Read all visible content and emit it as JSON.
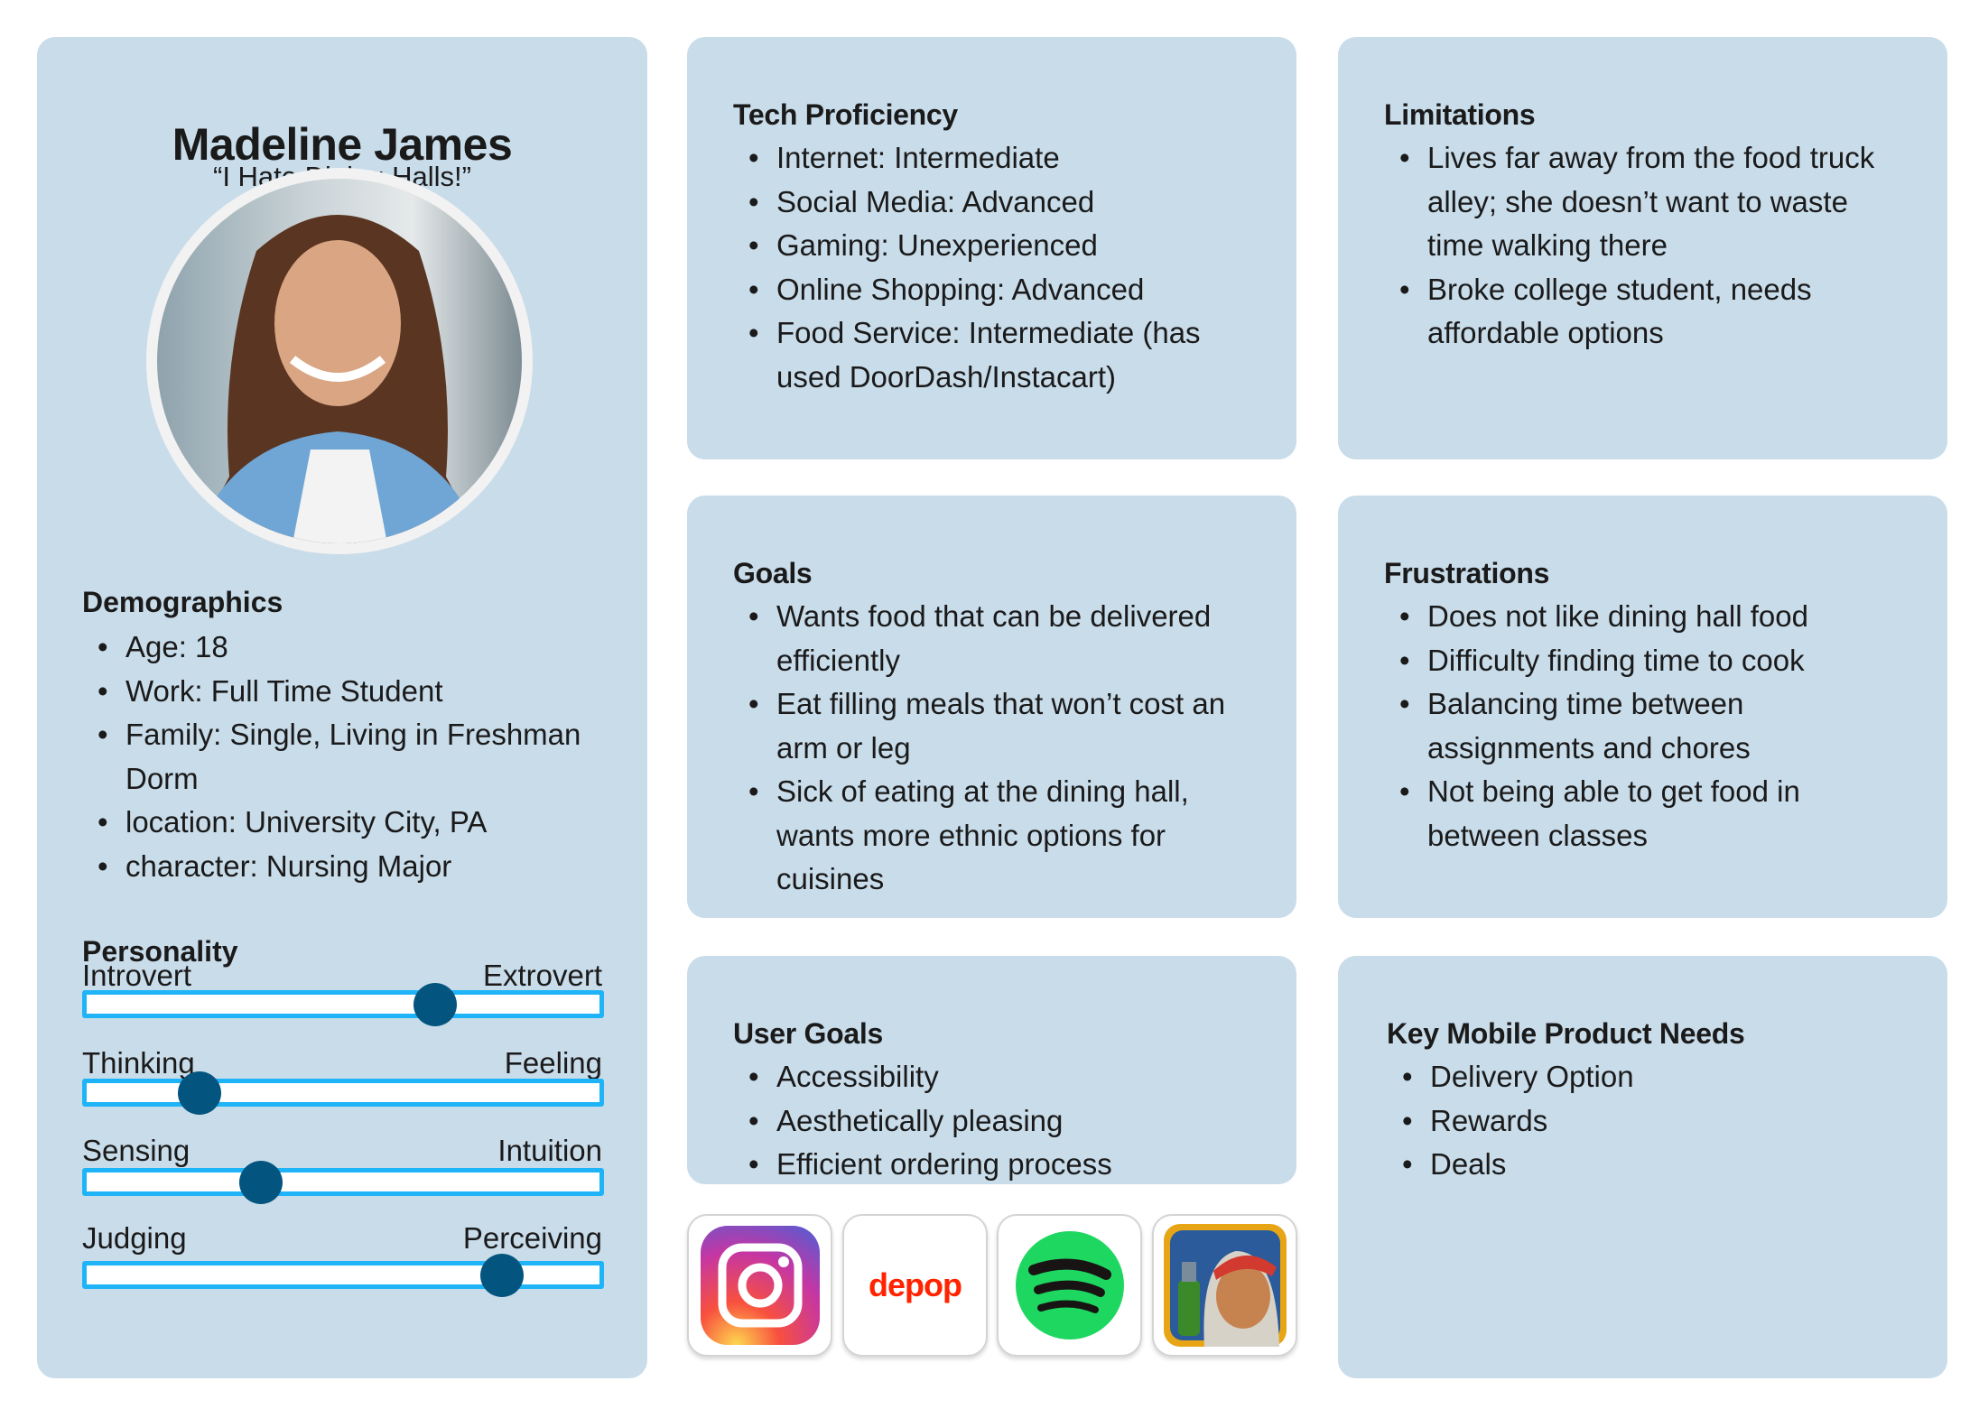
{
  "persona": {
    "name": "Madeline James",
    "quote": "“I Hate Dining Halls!”"
  },
  "demographics": {
    "title": "Demographics",
    "items": [
      "Age: 18",
      "Work: Full Time Student",
      "Family: Single, Living in Freshman Dorm",
      "location: University City, PA",
      "character: Nursing Major"
    ]
  },
  "personality": {
    "title": "Personality",
    "scales": [
      {
        "left": "Introvert",
        "right": "Extrovert",
        "value": 0.68
      },
      {
        "left": "Thinking",
        "right": "Feeling",
        "value": 0.22
      },
      {
        "left": "Sensing",
        "right": "Intuition",
        "value": 0.34
      },
      {
        "left": "Judging",
        "right": "Perceiving",
        "value": 0.81
      }
    ]
  },
  "tech": {
    "title": "Tech Proficiency",
    "items": [
      "Internet: Intermediate",
      "Social Media: Advanced",
      "Gaming: Unexperienced",
      "Online Shopping: Advanced",
      "Food Service: Intermediate (has used DoorDash/Instacart)"
    ]
  },
  "limitations": {
    "title": "Limitations",
    "items": [
      "Lives far away from the food truck alley; she doesn’t want to waste time walking there",
      "Broke college student, needs affordable options"
    ]
  },
  "goals": {
    "title": "Goals",
    "items": [
      "Wants food that can be delivered efficiently",
      "Eat filling meals that won’t cost an arm or leg",
      "Sick of eating at the dining hall, wants more ethnic options for cuisines"
    ]
  },
  "frustrations": {
    "title": "Frustrations",
    "items": [
      "Does not like dining hall food",
      "Difficulty finding time to cook",
      "Balancing time between assignments and chores",
      "Not being able to get food in between classes"
    ]
  },
  "user_goals": {
    "title": "User Goals",
    "items": [
      "Accessibility",
      "Aesthetically pleasing",
      "Efficient ordering process"
    ]
  },
  "needs": {
    "title": "Key Mobile Product Needs",
    "items": [
      "Delivery Option",
      "Rewards",
      "Deals"
    ]
  },
  "apps": {
    "depop": "depop",
    "colors": {
      "depop": "#ff2300",
      "spotify": "#1ed760",
      "slider": "#1eb4f7",
      "knob": "#03557f",
      "panel": "#c9dcea"
    }
  }
}
